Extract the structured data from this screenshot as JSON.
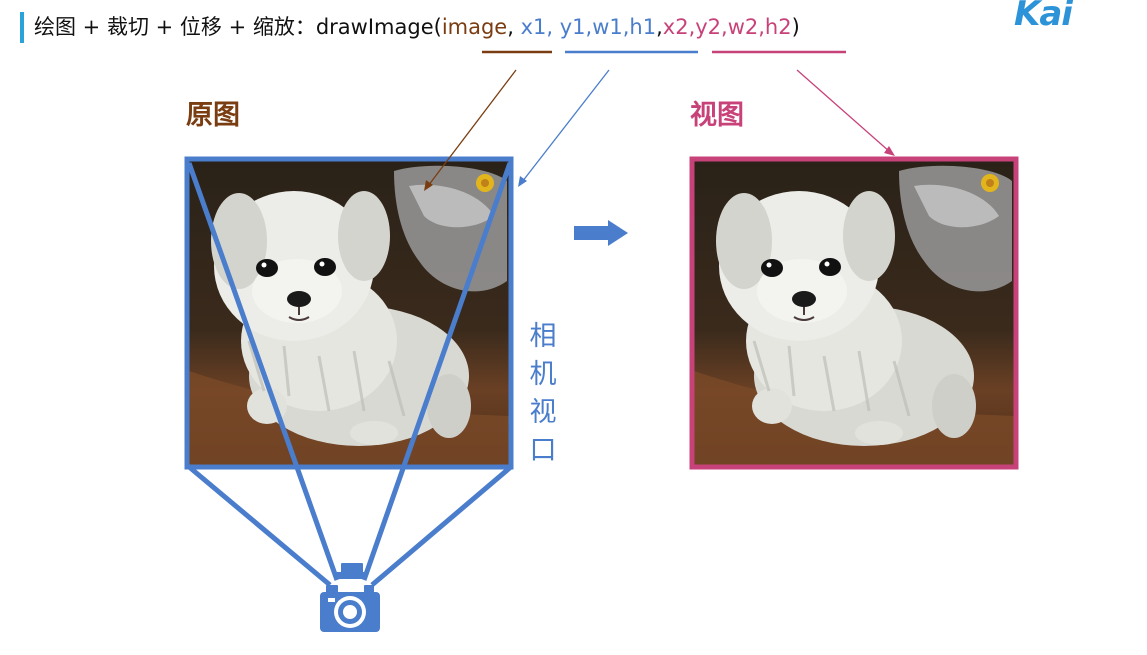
{
  "title": {
    "prefix": "绘图 + 裁切 + 位移 + 缩放：drawImage( ",
    "image_param": "image",
    "comma1": ", ",
    "src_params": "x1, y1,w1,h1",
    "comma2": ",",
    "dst_params": "x2,y2,w2,h2",
    "suffix": ")"
  },
  "logo": "Kai",
  "labels": {
    "source": "原图",
    "view": "视图",
    "camera_viewport": "相机视口"
  },
  "colors": {
    "accent_bar": "#2aa3d9",
    "image_param": "#7a3d12",
    "src_params": "#4a7dcc",
    "dst_params": "#c8427a",
    "frame_source": "#4a7dcc",
    "frame_view": "#c8427a",
    "arrow": "#4a7dcc"
  },
  "icons": [
    "camera-icon",
    "right-arrow-icon",
    "puppy-image"
  ]
}
